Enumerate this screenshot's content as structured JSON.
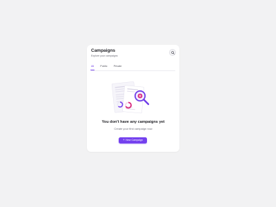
{
  "header": {
    "title": "Campaigns",
    "subtitle": "Explore your campaigns",
    "search_icon": "search-icon"
  },
  "tabs": [
    {
      "label": "All",
      "active": true
    },
    {
      "label": "Public",
      "active": false
    },
    {
      "label": "Private",
      "active": false
    }
  ],
  "empty_state": {
    "illustration_icon": "campaign-document-magnifier-icon",
    "title": "You don't have any campaigns yet",
    "subtitle": "Create your first campaign now",
    "button_icon": "plus-icon",
    "button_label": "New Campaign"
  },
  "colors": {
    "accent": "#7441ee",
    "accent_pink": "#d9257a",
    "background": "#f2f2f3",
    "card": "#ffffff"
  }
}
